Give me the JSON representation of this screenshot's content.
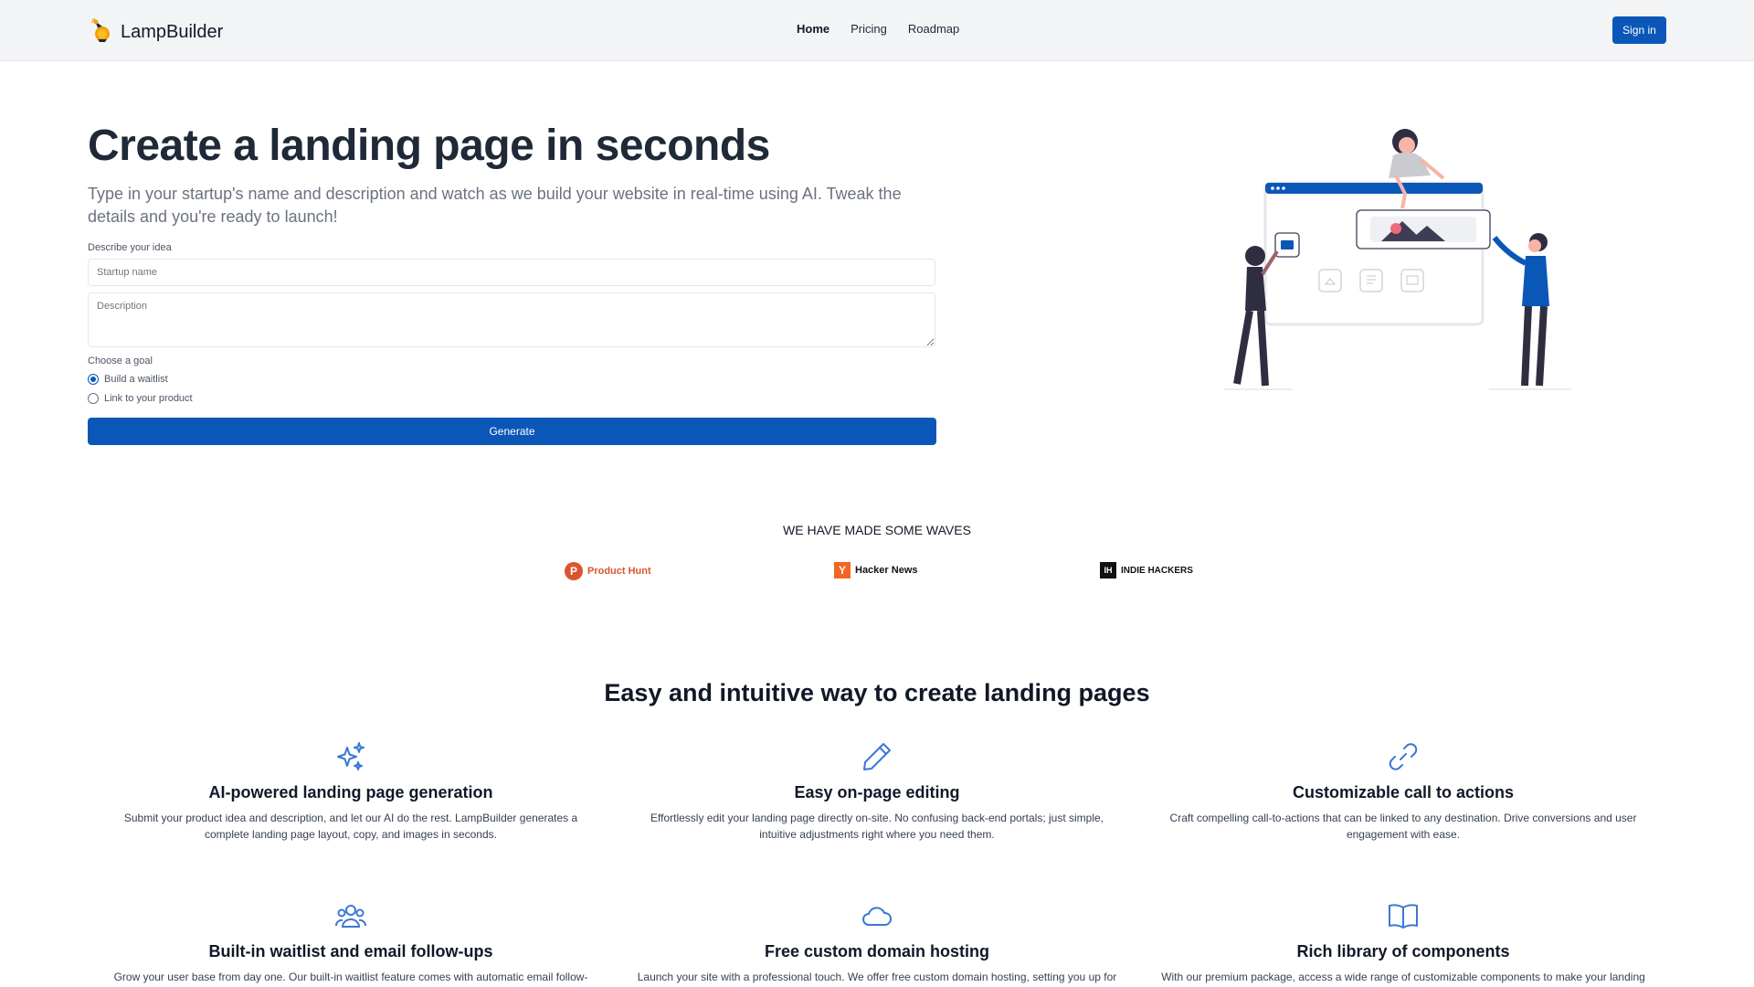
{
  "navbar": {
    "brand": "LampBuilder",
    "links": [
      "Home",
      "Pricing",
      "Roadmap"
    ],
    "active_link": "Home",
    "signin_label": "Sign in"
  },
  "hero": {
    "title": "Create a landing page in seconds",
    "subtitle": "Type in your startup's name and description and watch as we build your website in real-time using AI. Tweak the details and you're ready to launch!",
    "form_label": "Describe your idea",
    "name_placeholder": "Startup name",
    "description_placeholder": "Description",
    "goal_label": "Choose a goal",
    "goals": [
      "Build a waitlist",
      "Link to your product"
    ],
    "selected_goal": "Build a waitlist",
    "generate_label": "Generate"
  },
  "waves": {
    "title": "WE HAVE MADE SOME WAVES",
    "logos": [
      {
        "name": "Product Hunt",
        "icon": "P",
        "color": "#da552f"
      },
      {
        "name": "Hacker News",
        "icon": "Y",
        "color": "#f26522"
      },
      {
        "name": "INDIE HACKERS",
        "icon": "IH",
        "color": "#111111"
      }
    ]
  },
  "features": {
    "title": "Easy and intuitive way to create landing pages",
    "items": [
      {
        "icon": "sparkles-icon",
        "title": "AI-powered landing page generation",
        "desc": "Submit your product idea and description, and let our AI do the rest. LampBuilder generates a complete landing page layout, copy, and images in seconds."
      },
      {
        "icon": "pencil-icon",
        "title": "Easy on-page editing",
        "desc": "Effortlessly edit your landing page directly on-site. No confusing back-end portals; just simple, intuitive adjustments right where you need them."
      },
      {
        "icon": "link-icon",
        "title": "Customizable call to actions",
        "desc": "Craft compelling call-to-actions that can be linked to any destination. Drive conversions and user engagement with ease."
      },
      {
        "icon": "users-icon",
        "title": "Built-in waitlist and email follow-ups",
        "desc": "Grow your user base from day one. Our built-in waitlist feature comes with automatic email follow-"
      },
      {
        "icon": "cloud-icon",
        "title": "Free custom domain hosting",
        "desc": "Launch your site with a professional touch. We offer free custom domain hosting, setting you up for"
      },
      {
        "icon": "book-open-icon",
        "title": "Rich library of components",
        "desc": "With our premium package, access a wide range of customizable components to make your landing"
      }
    ]
  },
  "colors": {
    "primary": "#0b57b8",
    "icon_blue": "#3b78d4",
    "nav_bg": "#f3f4f6"
  }
}
